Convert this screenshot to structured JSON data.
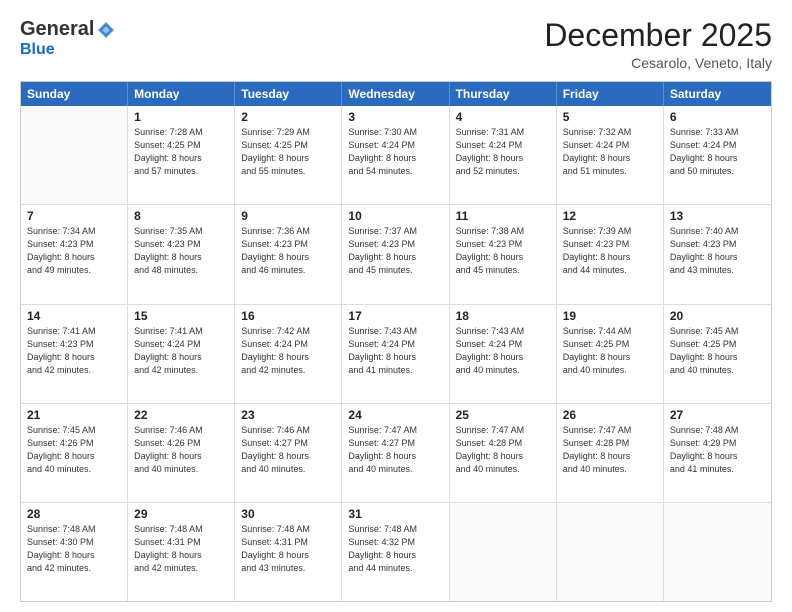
{
  "header": {
    "logo": {
      "general": "General",
      "blue": "Blue"
    },
    "title": "December 2025",
    "subtitle": "Cesarolo, Veneto, Italy"
  },
  "weekdays": [
    "Sunday",
    "Monday",
    "Tuesday",
    "Wednesday",
    "Thursday",
    "Friday",
    "Saturday"
  ],
  "rows": [
    [
      {
        "day": "",
        "info": ""
      },
      {
        "day": "1",
        "info": "Sunrise: 7:28 AM\nSunset: 4:25 PM\nDaylight: 8 hours\nand 57 minutes."
      },
      {
        "day": "2",
        "info": "Sunrise: 7:29 AM\nSunset: 4:25 PM\nDaylight: 8 hours\nand 55 minutes."
      },
      {
        "day": "3",
        "info": "Sunrise: 7:30 AM\nSunset: 4:24 PM\nDaylight: 8 hours\nand 54 minutes."
      },
      {
        "day": "4",
        "info": "Sunrise: 7:31 AM\nSunset: 4:24 PM\nDaylight: 8 hours\nand 52 minutes."
      },
      {
        "day": "5",
        "info": "Sunrise: 7:32 AM\nSunset: 4:24 PM\nDaylight: 8 hours\nand 51 minutes."
      },
      {
        "day": "6",
        "info": "Sunrise: 7:33 AM\nSunset: 4:24 PM\nDaylight: 8 hours\nand 50 minutes."
      }
    ],
    [
      {
        "day": "7",
        "info": "Sunrise: 7:34 AM\nSunset: 4:23 PM\nDaylight: 8 hours\nand 49 minutes."
      },
      {
        "day": "8",
        "info": "Sunrise: 7:35 AM\nSunset: 4:23 PM\nDaylight: 8 hours\nand 48 minutes."
      },
      {
        "day": "9",
        "info": "Sunrise: 7:36 AM\nSunset: 4:23 PM\nDaylight: 8 hours\nand 46 minutes."
      },
      {
        "day": "10",
        "info": "Sunrise: 7:37 AM\nSunset: 4:23 PM\nDaylight: 8 hours\nand 45 minutes."
      },
      {
        "day": "11",
        "info": "Sunrise: 7:38 AM\nSunset: 4:23 PM\nDaylight: 8 hours\nand 45 minutes."
      },
      {
        "day": "12",
        "info": "Sunrise: 7:39 AM\nSunset: 4:23 PM\nDaylight: 8 hours\nand 44 minutes."
      },
      {
        "day": "13",
        "info": "Sunrise: 7:40 AM\nSunset: 4:23 PM\nDaylight: 8 hours\nand 43 minutes."
      }
    ],
    [
      {
        "day": "14",
        "info": "Sunrise: 7:41 AM\nSunset: 4:23 PM\nDaylight: 8 hours\nand 42 minutes."
      },
      {
        "day": "15",
        "info": "Sunrise: 7:41 AM\nSunset: 4:24 PM\nDaylight: 8 hours\nand 42 minutes."
      },
      {
        "day": "16",
        "info": "Sunrise: 7:42 AM\nSunset: 4:24 PM\nDaylight: 8 hours\nand 42 minutes."
      },
      {
        "day": "17",
        "info": "Sunrise: 7:43 AM\nSunset: 4:24 PM\nDaylight: 8 hours\nand 41 minutes."
      },
      {
        "day": "18",
        "info": "Sunrise: 7:43 AM\nSunset: 4:24 PM\nDaylight: 8 hours\nand 40 minutes."
      },
      {
        "day": "19",
        "info": "Sunrise: 7:44 AM\nSunset: 4:25 PM\nDaylight: 8 hours\nand 40 minutes."
      },
      {
        "day": "20",
        "info": "Sunrise: 7:45 AM\nSunset: 4:25 PM\nDaylight: 8 hours\nand 40 minutes."
      }
    ],
    [
      {
        "day": "21",
        "info": "Sunrise: 7:45 AM\nSunset: 4:26 PM\nDaylight: 8 hours\nand 40 minutes."
      },
      {
        "day": "22",
        "info": "Sunrise: 7:46 AM\nSunset: 4:26 PM\nDaylight: 8 hours\nand 40 minutes."
      },
      {
        "day": "23",
        "info": "Sunrise: 7:46 AM\nSunset: 4:27 PM\nDaylight: 8 hours\nand 40 minutes."
      },
      {
        "day": "24",
        "info": "Sunrise: 7:47 AM\nSunset: 4:27 PM\nDaylight: 8 hours\nand 40 minutes."
      },
      {
        "day": "25",
        "info": "Sunrise: 7:47 AM\nSunset: 4:28 PM\nDaylight: 8 hours\nand 40 minutes."
      },
      {
        "day": "26",
        "info": "Sunrise: 7:47 AM\nSunset: 4:28 PM\nDaylight: 8 hours\nand 40 minutes."
      },
      {
        "day": "27",
        "info": "Sunrise: 7:48 AM\nSunset: 4:29 PM\nDaylight: 8 hours\nand 41 minutes."
      }
    ],
    [
      {
        "day": "28",
        "info": "Sunrise: 7:48 AM\nSunset: 4:30 PM\nDaylight: 8 hours\nand 42 minutes."
      },
      {
        "day": "29",
        "info": "Sunrise: 7:48 AM\nSunset: 4:31 PM\nDaylight: 8 hours\nand 42 minutes."
      },
      {
        "day": "30",
        "info": "Sunrise: 7:48 AM\nSunset: 4:31 PM\nDaylight: 8 hours\nand 43 minutes."
      },
      {
        "day": "31",
        "info": "Sunrise: 7:48 AM\nSunset: 4:32 PM\nDaylight: 8 hours\nand 44 minutes."
      },
      {
        "day": "",
        "info": ""
      },
      {
        "day": "",
        "info": ""
      },
      {
        "day": "",
        "info": ""
      }
    ]
  ]
}
